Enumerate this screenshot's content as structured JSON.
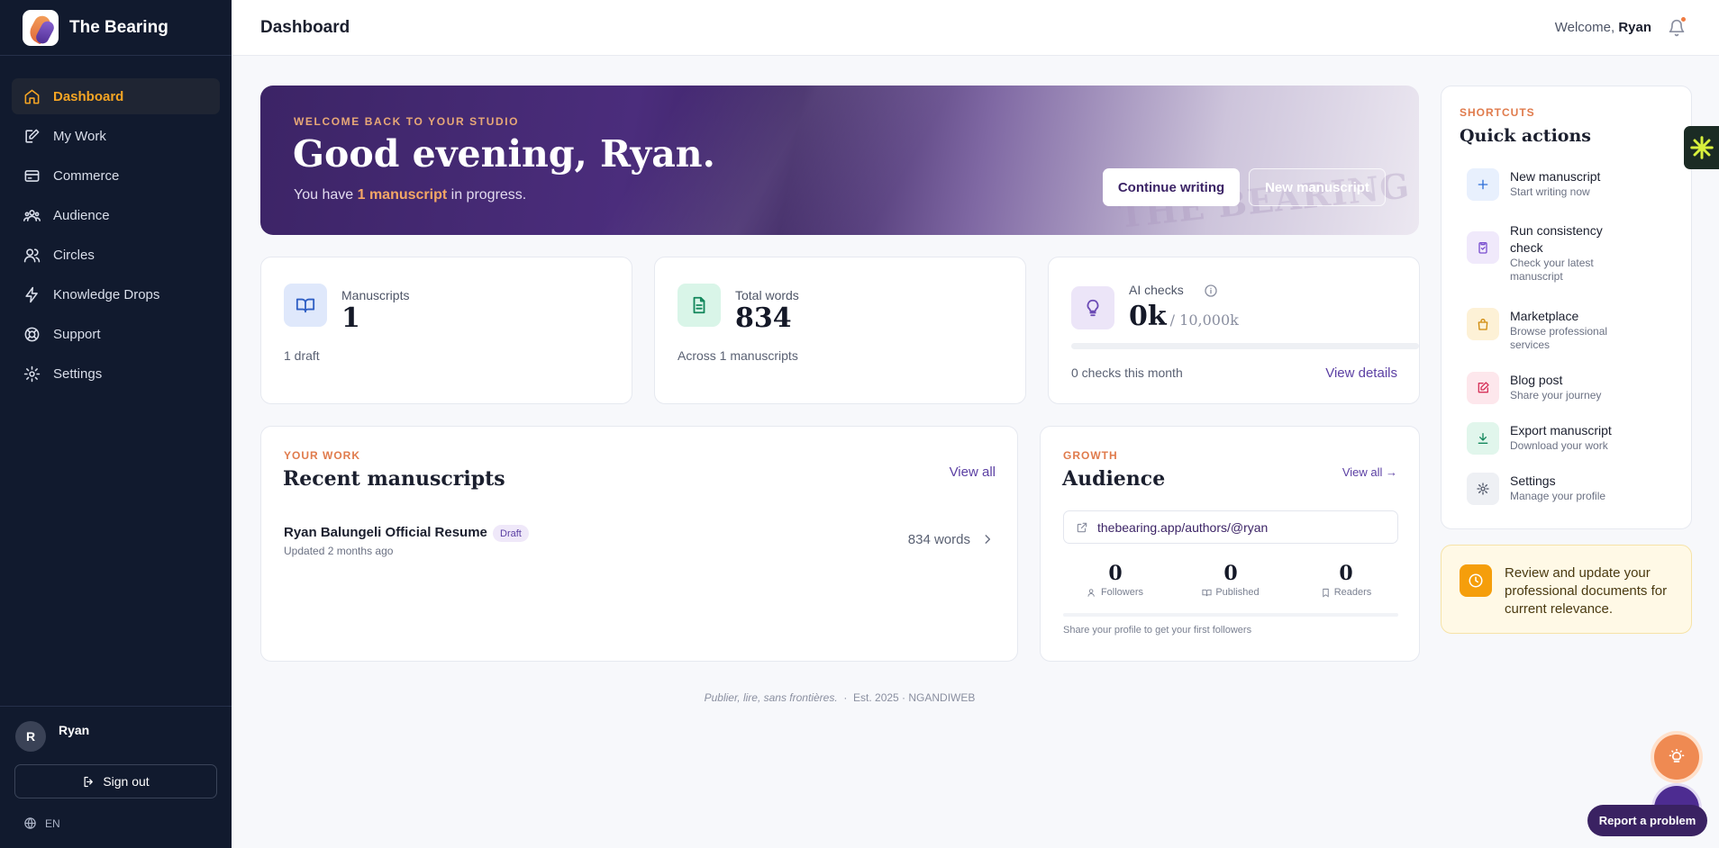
{
  "app": {
    "name": "The Bearing"
  },
  "sidebar": {
    "items": [
      {
        "label": "Dashboard",
        "icon": "home-icon",
        "active": true
      },
      {
        "label": "My Work",
        "icon": "edit-icon"
      },
      {
        "label": "Commerce",
        "icon": "credit-card-icon"
      },
      {
        "label": "Audience",
        "icon": "users-group-icon"
      },
      {
        "label": "Circles",
        "icon": "users-icon"
      },
      {
        "label": "Knowledge Drops",
        "icon": "bolt-icon"
      },
      {
        "label": "Support",
        "icon": "lifebuoy-icon"
      },
      {
        "label": "Settings",
        "icon": "gear-icon"
      }
    ],
    "user": {
      "initial": "R",
      "name": "Ryan"
    },
    "signout_label": "Sign out",
    "language": "EN"
  },
  "header": {
    "title": "Dashboard",
    "welcome_prefix": "Welcome,",
    "welcome_name": "Ryan"
  },
  "hero": {
    "eyebrow": "WELCOME BACK TO YOUR STUDIO",
    "greeting": "Good evening, Ryan.",
    "sub_prefix": "You have",
    "sub_highlight": "1 manuscript",
    "sub_suffix": "in progress.",
    "continue_label": "Continue writing",
    "new_label": "New manuscript",
    "watermark": "THE BEARING"
  },
  "stats": {
    "manuscripts": {
      "label": "Manuscripts",
      "value": "1",
      "foot": "1 draft"
    },
    "words": {
      "label": "Total words",
      "value": "834",
      "foot": "Across 1 manuscripts"
    },
    "ai": {
      "label": "AI checks",
      "value": "0k",
      "limit": "/ 10,000k",
      "progress": 0,
      "foot": "0 checks this month",
      "link": "View details"
    }
  },
  "recent": {
    "eyebrow": "YOUR WORK",
    "title": "Recent manuscripts",
    "view_all": "View all",
    "items": [
      {
        "title": "Ryan Balungeli Official Resume",
        "badge": "Draft",
        "updated": "Updated 2 months ago",
        "words": "834 words"
      }
    ]
  },
  "audience": {
    "eyebrow": "GROWTH",
    "title": "Audience",
    "view_all": "View all →",
    "link": "thebearing.app/authors/@ryan",
    "stats": [
      {
        "value": "0",
        "label": "Followers"
      },
      {
        "value": "0",
        "label": "Published"
      },
      {
        "value": "0",
        "label": "Readers"
      }
    ],
    "hint": "Share your profile to get your first followers"
  },
  "shortcuts": {
    "eyebrow": "SHORTCUTS",
    "title": "Quick actions",
    "items": [
      {
        "title": "New manuscript",
        "sub": "Start writing now"
      },
      {
        "title": "Run consistency check",
        "sub": "Check your latest manuscript"
      },
      {
        "title": "Marketplace",
        "sub": "Browse professional services"
      },
      {
        "title": "Blog post",
        "sub": "Share your journey"
      },
      {
        "title": "Export manuscript",
        "sub": "Download your work"
      },
      {
        "title": "Settings",
        "sub": "Manage your profile"
      }
    ]
  },
  "review": {
    "text": "Review and update your professional documents for current relevance."
  },
  "footer": {
    "tagline": "Publier, lire, sans frontières.",
    "sep": "·",
    "est": "Est. 2025 · NGANDIWEB"
  },
  "report_label": "Report a problem",
  "colors": {
    "accent": "#f5a524",
    "brand_purple": "#3c2466",
    "sidebar_bg": "#111a2e",
    "link": "#5b3fa3",
    "eyebrow": "#e07b4c"
  }
}
